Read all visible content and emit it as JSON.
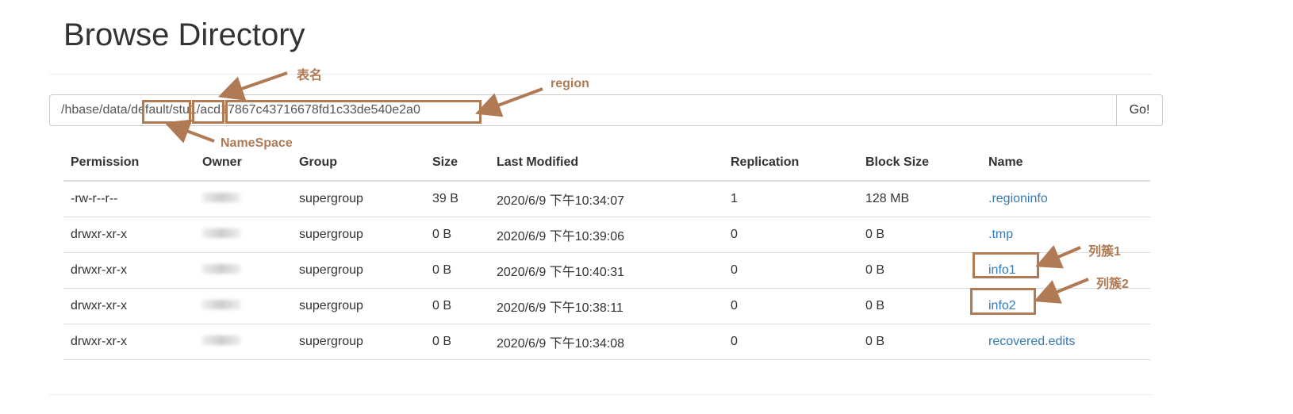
{
  "title": "Browse Directory",
  "path": {
    "value": "/hbase/data/default/stu1/acd17867c43716678fd1c33de540e2a0",
    "go_label": "Go!"
  },
  "table": {
    "headers": [
      "Permission",
      "Owner",
      "Group",
      "Size",
      "Last Modified",
      "Replication",
      "Block Size",
      "Name"
    ],
    "rows": [
      [
        "-rw-r--r--",
        "",
        "supergroup",
        "39 B",
        "2020/6/9 下午10:34:07",
        "1",
        "128 MB",
        ".regioninfo"
      ],
      [
        "drwxr-xr-x",
        "",
        "supergroup",
        "0 B",
        "2020/6/9 下午10:39:06",
        "0",
        "0 B",
        ".tmp"
      ],
      [
        "drwxr-xr-x",
        "",
        "supergroup",
        "0 B",
        "2020/6/9 下午10:40:31",
        "0",
        "0 B",
        "info1"
      ],
      [
        "drwxr-xr-x",
        "",
        "supergroup",
        "0 B",
        "2020/6/9 下午10:38:11",
        "0",
        "0 B",
        "info2"
      ],
      [
        "drwxr-xr-x",
        "",
        "supergroup",
        "0 B",
        "2020/6/9 下午10:34:08",
        "0",
        "0 B",
        "recovered.edits"
      ]
    ]
  },
  "annotations": {
    "table_name": "表名",
    "region": "region",
    "namespace": "NameSpace",
    "cf1": "列簇1",
    "cf2": "列簇2",
    "color": "#b07a54"
  }
}
